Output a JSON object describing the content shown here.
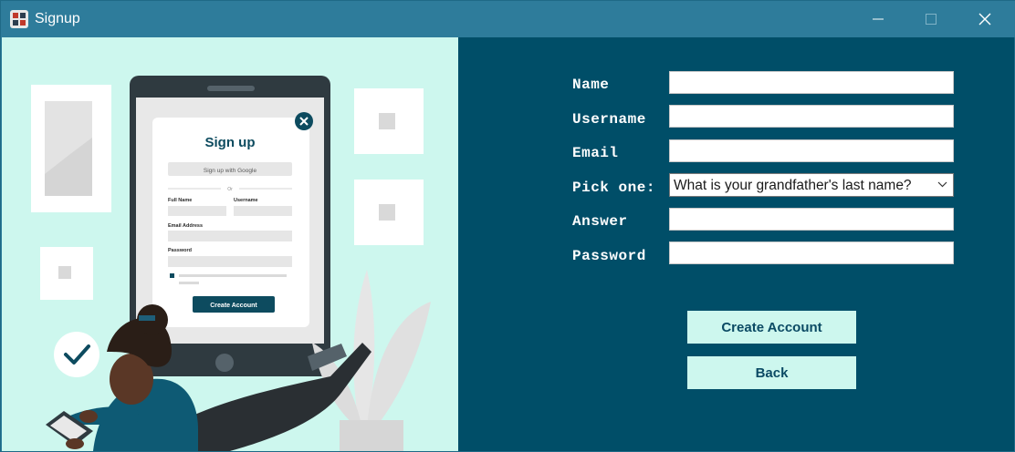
{
  "window": {
    "title": "Signup",
    "icons": {
      "app": "app-icon",
      "minimize": "minimize-icon",
      "maximize": "maximize-icon",
      "close": "close-icon"
    }
  },
  "illustration": {
    "title": "Sign up",
    "google_button": "Sign up with Google",
    "divider": "Or",
    "full_name": "Full Name",
    "username": "Username",
    "email": "Email Address",
    "password": "Password",
    "create_button": "Create Account"
  },
  "form": {
    "name_label": "Name",
    "username_label": "Username",
    "email_label": "Email",
    "pick_label": "Pick one:",
    "answer_label": "Answer",
    "password_label": "Password",
    "name_value": "",
    "username_value": "",
    "email_value": "",
    "answer_value": "",
    "password_value": "",
    "security_question": "What is your grandfather's last name?"
  },
  "buttons": {
    "create": "Create Account",
    "back": "Back"
  },
  "colors": {
    "titlebar": "#2e7c9b",
    "form_bg": "#004e68",
    "mint": "#cdf7ee",
    "button_text": "#0b4a64"
  }
}
